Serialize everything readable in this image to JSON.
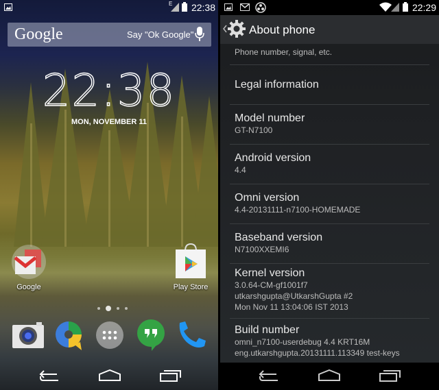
{
  "left_screen": {
    "status_bar": {
      "time": "22:38",
      "network_type": "E",
      "icons": [
        "gallery-icon",
        "signal-icon",
        "battery-icon"
      ]
    },
    "search_bar": {
      "logo": "Google",
      "hint": "Say \"Ok Google\"",
      "icon": "mic-icon"
    },
    "clock": {
      "time": "22:38",
      "date": "MON, NOVEMBER 11"
    },
    "home_apps": [
      {
        "label": "Google",
        "icon": "google-folder-icon"
      },
      {
        "label": "Play Store",
        "icon": "play-store-icon"
      }
    ],
    "page_indicator": {
      "pages": 4,
      "current": 2
    },
    "dock": [
      {
        "name": "Camera",
        "icon": "camera-icon"
      },
      {
        "name": "Quickoffice",
        "icon": "quickoffice-icon"
      },
      {
        "name": "Apps",
        "icon": "app-drawer-icon"
      },
      {
        "name": "Hangouts",
        "icon": "hangouts-icon"
      },
      {
        "name": "Phone",
        "icon": "phone-icon"
      }
    ],
    "nav": [
      "back-icon",
      "home-icon",
      "recents-icon"
    ]
  },
  "right_screen": {
    "status_bar": {
      "time": "22:29",
      "icons": [
        "gallery-icon",
        "gmail-icon",
        "omni-icon",
        "wifi-icon",
        "signal-icon",
        "battery-icon"
      ]
    },
    "action_bar": {
      "title": "About phone"
    },
    "items": [
      {
        "title": "",
        "lines": [
          "Phone number, signal, etc."
        ]
      },
      {
        "title": "Legal information",
        "lines": []
      },
      {
        "title": "Model number",
        "lines": [
          "GT-N7100"
        ]
      },
      {
        "title": "Android version",
        "lines": [
          "4.4"
        ]
      },
      {
        "title": "Omni version",
        "lines": [
          "4.4-20131111-n7100-HOMEMADE"
        ]
      },
      {
        "title": "Baseband version",
        "lines": [
          "N7100XXEMI6"
        ]
      },
      {
        "title": "Kernel version",
        "lines": [
          "3.0.64-CM-gf1001f7",
          "utkarshgupta@UtkarshGupta #2",
          "Mon Nov 11 13:04:06 IST 2013"
        ]
      },
      {
        "title": "Build number",
        "lines": [
          "omni_n7100-userdebug 4.4 KRT16M",
          "eng.utkarshgupta.20131111.113349 test-keys"
        ]
      }
    ],
    "nav": [
      "back-icon",
      "home-icon",
      "recents-icon"
    ]
  }
}
